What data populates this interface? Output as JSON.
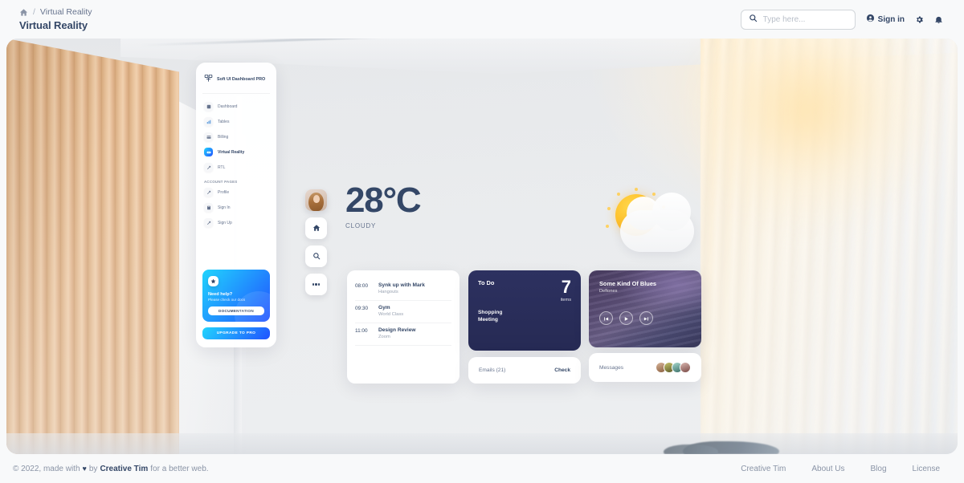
{
  "topbar": {
    "breadcrumb_home_icon": "home-icon",
    "breadcrumb_separator": "/",
    "breadcrumb_current": "Virtual Reality",
    "page_title": "Virtual Reality",
    "search_placeholder": "Type here...",
    "search_value": "",
    "search_icon": "search-icon",
    "sign_in_label": "Sign in",
    "sign_in_icon": "user-circle-icon",
    "settings_icon": "gear-icon",
    "notifications_icon": "bell-icon"
  },
  "vr_sidebar": {
    "brand": "Soft UI Dashboard PRO",
    "brand_icon": "soft-ui-logo-icon",
    "items": [
      {
        "label": "Dashboard",
        "icon": "dashboard-icon",
        "active": false
      },
      {
        "label": "Tables",
        "icon": "tables-icon",
        "active": false
      },
      {
        "label": "Billing",
        "icon": "billing-icon",
        "active": false
      },
      {
        "label": "Virtual Reality",
        "icon": "vr-icon",
        "active": true
      },
      {
        "label": "RTL",
        "icon": "rtl-icon",
        "active": false
      }
    ],
    "section_header": "ACCOUNT PAGES",
    "account_items": [
      {
        "label": "Profile",
        "icon": "profile-icon"
      },
      {
        "label": "Sign In",
        "icon": "sign-in-icon"
      },
      {
        "label": "Sign Up",
        "icon": "sign-up-icon"
      }
    ],
    "help_card": {
      "badge_icon": "star-icon",
      "title": "Need help?",
      "subtitle": "Please check our docs",
      "button_label": "DOCUMENTATION"
    },
    "upgrade_button_label": "UPGRADE TO PRO"
  },
  "rail": {
    "avatar_name": "user-avatar",
    "buttons": [
      {
        "icon": "home-icon",
        "name": "rail-home-button"
      },
      {
        "icon": "search-icon",
        "name": "rail-search-button"
      },
      {
        "icon": "more-icon",
        "name": "rail-more-button"
      }
    ]
  },
  "weather": {
    "temperature": "28°C",
    "condition": "CLOUDY",
    "icon": "sun-behind-cloud-icon"
  },
  "schedule": {
    "rows": [
      {
        "time": "08:00",
        "title": "Synk up with Mark",
        "sub": "Hangouts"
      },
      {
        "time": "09:30",
        "title": "Gym",
        "sub": "World Class"
      },
      {
        "time": "11:00",
        "title": "Design Review",
        "sub": "Zoom"
      }
    ],
    "expand_icon": "chevron-down-icon"
  },
  "todo": {
    "title": "To Do",
    "count": "7",
    "count_label": "items",
    "items": [
      "Shopping",
      "Meeting"
    ],
    "expand_icon": "chevron-down-icon"
  },
  "emails": {
    "label": "Emails (21)",
    "action": "Check"
  },
  "music": {
    "title": "Some Kind Of Blues",
    "artist": "Deftones",
    "controls": [
      {
        "icon": "previous-icon",
        "name": "music-previous-button"
      },
      {
        "icon": "play-icon",
        "name": "music-play-button"
      },
      {
        "icon": "next-icon",
        "name": "music-next-button"
      }
    ]
  },
  "messages": {
    "label": "Messages",
    "avatar_count": 4
  },
  "footer": {
    "copyright_prefix": "© 2022, made with",
    "heart_icon": "heart-icon",
    "by": "by",
    "brand": "Creative Tim",
    "suffix": "for a better web.",
    "links": [
      "Creative Tim",
      "About Us",
      "Blog",
      "License"
    ]
  },
  "colors": {
    "accent_blue": "#21d4fd",
    "accent_blue_dark": "#2152ff",
    "text_dark": "#344767",
    "text_muted": "#67748e",
    "todo_card": "#2d3160"
  }
}
